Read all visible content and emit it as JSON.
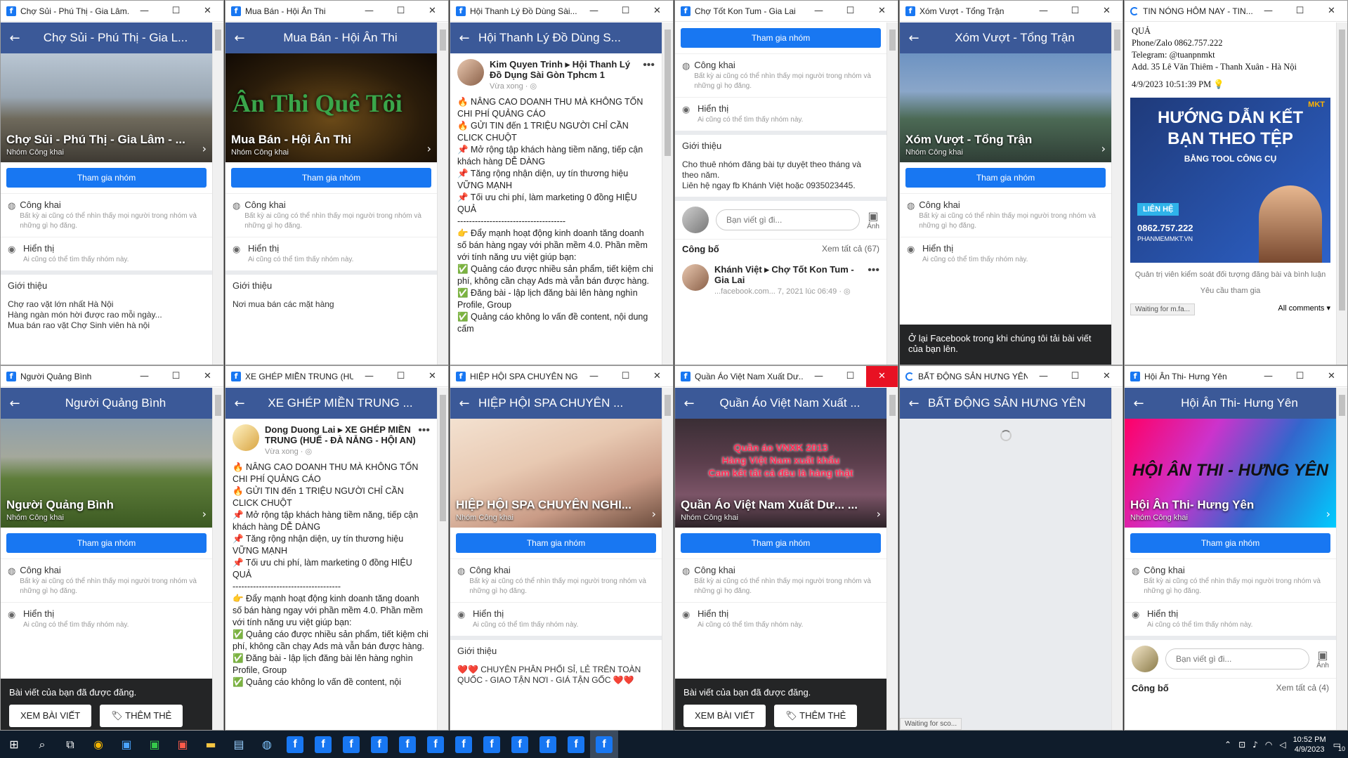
{
  "win1": {
    "tab_title": "Chợ Sủi - Phú Thị - Gia Lâm...",
    "nav_title": "Chợ Sủi - Phú Thị - Gia L...",
    "cover_name": "Chợ Sủi - Phú Thị - Gia Lâm - ...",
    "cover_type": "Nhóm Công khai",
    "join": "Tham gia nhóm",
    "public_title": "Công khai",
    "public_desc": "Bất kỳ ai cũng có thể nhìn thấy mọi người trong nhóm và những gì họ đăng.",
    "visible_title": "Hiển thị",
    "visible_desc": "Ai cũng có thể tìm thấy nhóm này.",
    "intro": "Giới thiệu",
    "about": "Chợ rao vặt lớn nhất Hà Nội\nHàng ngàn món hời được rao mỗi ngày...\nMua bán rao vặt Chợ Sinh viên hà nội"
  },
  "win2": {
    "tab_title": "Mua Bán - Hội Ân Thi",
    "nav_title": "Mua Bán - Hội Ân Thi",
    "cover_art": "Ân Thi Quê Tôi",
    "cover_name": "Mua Bán - Hội Ân Thi",
    "cover_type": "Nhóm Công khai",
    "join": "Tham gia nhóm",
    "public_title": "Công khai",
    "public_desc": "Bất kỳ ai cũng có thể nhìn thấy mọi người trong nhóm và những gì họ đăng.",
    "visible_title": "Hiển thị",
    "visible_desc": "Ai cũng có thể tìm thấy nhóm này.",
    "intro": "Giới thiệu",
    "about": "Nơi mua bán các mặt hàng"
  },
  "win3": {
    "tab_title": "Hội Thanh Lý Đồ Dùng Sài...",
    "nav_title": "Hội Thanh Lý Đồ Dùng S...",
    "author": "Kim Quyen Trinh ▸ Hội Thanh Lý Đồ Dụng Sài Gòn Tphcm 1",
    "time": "Vừa xong · ◎",
    "body": "🔥 NÂNG CAO DOANH THU MÀ KHÔNG TỐN CHI PHÍ QUẢNG CÁO\n🔥 GỬI TIN đến 1 TRIỆU NGƯỜI CHỈ CẦN CLICK CHUỘT\n📌 Mở rộng tập khách hàng tiềm năng, tiếp cận khách hàng DỄ DÀNG\n📌 Tăng rộng nhận diện, uy tín thương hiệu VỮNG MẠNH\n📌 Tối ưu chi phí, làm marketing 0 đồng HIỆU QUẢ\n-------------------------------------\n👉 Đẩy mạnh hoạt động kinh doanh tăng doanh số bán hàng ngay với phần mềm 4.0. Phần mềm với tính năng ưu việt giúp bạn:\n✅ Quảng cáo được nhiều sản phẩm, tiết kiệm chi phí, không cần chạy Ads mà vẫn bán được hàng.\n✅ Đăng bài - lập lịch đăng bài lên hàng nghìn Profile, Group\n✅ Quảng cáo không lo vấn đề content, nội dung cấm"
  },
  "win4": {
    "tab_title": "Chợ Tốt Kon Tum - Gia Lai",
    "join": "Tham gia nhóm",
    "public_title": "Công khai",
    "public_desc": "Bất kỳ ai cũng có thể nhìn thấy mọi người trong nhóm và những gì họ đăng.",
    "visible_title": "Hiển thị",
    "visible_desc": "Ai cũng có thể tìm thấy nhóm này.",
    "intro": "Giới thiệu",
    "about": "Cho thuê nhóm đăng bài tự duyệt theo tháng và theo năm.\nLiên hệ ngay fb Khánh Việt hoặc 0935023445.",
    "compose_placeholder": "Bạn viết gì đi...",
    "photo_label": "Ảnh",
    "public_posts": "Công bố",
    "see_all": "Xem tất cả (67)",
    "post_author": "Khánh Việt ▸ Chợ Tốt Kon Tum - Gia Lai",
    "post_time": "...facebook.com... 7, 2021 lúc 06:49 · ◎"
  },
  "win5": {
    "tab_title": "Xóm Vượt - Tổng Trận",
    "nav_title": "Xóm Vượt - Tổng Trận",
    "cover_name": "Xóm Vượt - Tổng Trận",
    "cover_type": "Nhóm Công khai",
    "join": "Tham gia nhóm",
    "public_title": "Công khai",
    "public_desc": "Bất kỳ ai cũng có thể nhìn thấy mọi người trong nhóm và những gì họ đăng.",
    "visible_title": "Hiển thị",
    "visible_desc": "Ai cũng có thể tìm thấy nhóm này.",
    "toast": "Ở lại Facebook trong khi chúng tôi tải bài viết của bạn lên."
  },
  "win6": {
    "tab_title": "TIN NÓNG HÔM NAY - TIN...",
    "news": "QUẢ\nPhone/Zalo 0862.757.222\nTelegram: @tuanpnmkt\nAdd. 35 Lê Văn Thiêm - Thanh Xuân - Hà Nội",
    "date": "4/9/2023 10:51:39 PM 💡",
    "ad_brand": "MKT",
    "ad_title": "HƯỚNG DẪN KẾT BẠN THEO TỆP",
    "ad_sub": "BẰNG TOOL CÔNG CỤ",
    "ad_contact": "LIÊN HỆ",
    "ad_phone": "0862.757.222",
    "ad_site": "PHANMEMMKT.VN",
    "admin_note": "Quản trị viên kiểm soát đối tượng đăng bài và bình luận",
    "request": "Yêu cầu tham gia",
    "status": "Waiting for m.fa...",
    "comments": "All comments ▾"
  },
  "win7": {
    "tab_title": "Người Quảng Bình",
    "nav_title": "Người Quảng Bình",
    "cover_name": "Người Quảng Bình",
    "cover_type": "Nhóm Công khai",
    "join": "Tham gia nhóm",
    "public_title": "Công khai",
    "public_desc": "Bất kỳ ai cũng có thể nhìn thấy mọi người trong nhóm và những gì họ đăng.",
    "visible_title": "Hiển thị",
    "visible_desc": "Ai cũng có thể tìm thấy nhóm này.",
    "toast": "Bài viết của bạn đã được đăng.",
    "view_post": "XEM BÀI VIẾT",
    "add_tag": "🏷 THÊM THẺ"
  },
  "win8": {
    "tab_title": "XE GHÉP MIỀN TRUNG (HU...",
    "nav_title": "XE GHÉP MIỀN TRUNG ...",
    "author": "Dong Duong Lai ▸ XE GHÉP MIỀN TRUNG (HUẾ - ĐÀ NẴNG - HỘI AN)",
    "time": "Vừa xong · ◎",
    "body": "🔥 NÂNG CAO DOANH THU MÀ KHÔNG TỐN CHI PHÍ QUẢNG CÁO\n🔥 GỬI TIN đến 1 TRIỆU NGƯỜI CHỈ CẦN CLICK CHUỘT\n📌 Mở rộng tập khách hàng tiềm năng, tiếp cận khách hàng DỄ DÀNG\n📌 Tăng rộng nhận diện, uy tín thương hiệu VỮNG MẠNH\n📌 Tối ưu chi phí, làm marketing 0 đồng HIỆU QUẢ\n-------------------------------------\n👉 Đẩy mạnh hoạt động kinh doanh tăng doanh số bán hàng ngay với phần mềm 4.0. Phần mềm với tính năng ưu việt giúp bạn:\n✅ Quảng cáo được nhiều sản phẩm, tiết kiệm chi phí, không cần chạy Ads mà vẫn bán được hàng.\n✅ Đăng bài - lập lịch đăng bài lên hàng nghìn Profile, Group\n✅ Quảng cáo không lo vấn đề content, nội"
  },
  "win9": {
    "tab_title": "HIỆP HỘI SPA CHUYÊN NG...",
    "nav_title": "HIỆP HỘI SPA CHUYÊN ...",
    "cover_name": "HIỆP HỘI SPA CHUYÊN NGHI...",
    "cover_type": "Nhóm Công khai",
    "join": "Tham gia nhóm",
    "public_title": "Công khai",
    "public_desc": "Bất kỳ ai cũng có thể nhìn thấy mọi người trong nhóm và những gì họ đăng.",
    "visible_title": "Hiển thị",
    "visible_desc": "Ai cũng có thể tìm thấy nhóm này.",
    "intro": "Giới thiệu",
    "about": "❤️❤️ CHUYÊN PHÂN PHỐI SỈ, LẺ TRÊN TOÀN QUỐC - GIAO TẬN NƠI - GIÁ TẬN GỐC ❤️❤️"
  },
  "win10": {
    "tab_title": "Quần Áo Việt Nam Xuất Dư...",
    "nav_title": "Quần Áo Việt Nam Xuất ...",
    "cover_art": "Quần áo VNXK 2013\nHàng Việt Nam xuất khẩu\nCam kết tất cả đều là hàng thật",
    "cover_name": "Quần Áo Việt Nam Xuất Dư... ...",
    "cover_type": "Nhóm Công khai",
    "join": "Tham gia nhóm",
    "public_title": "Công khai",
    "public_desc": "Bất kỳ ai cũng có thể nhìn thấy mọi người trong nhóm và những gì họ đăng.",
    "visible_title": "Hiển thị",
    "visible_desc": "Ai cũng có thể tìm thấy nhóm này.",
    "toast": "Bài viết của bạn đã được đăng.",
    "view_post": "XEM BÀI VIẾT",
    "add_tag": "🏷 THÊM THẺ"
  },
  "win11": {
    "tab_title": "BẤT ĐỘNG SẢN HƯNG YÊN",
    "nav_title": "BẤT ĐỘNG SẢN HƯNG YÊN",
    "status": "Waiting for sco..."
  },
  "win12": {
    "tab_title": "Hội Ân Thi- Hưng Yên",
    "nav_title": "Hội Ân Thi- Hưng Yên",
    "cover_art": "HỘI ÂN THI - HƯNG YÊN",
    "cover_name": "Hội Ân Thi- Hưng Yên",
    "cover_type": "Nhóm Công khai",
    "join": "Tham gia nhóm",
    "public_title": "Công khai",
    "public_desc": "Bất kỳ ai cũng có thể nhìn thấy mọi người trong nhóm và những gì họ đăng.",
    "visible_title": "Hiển thị",
    "visible_desc": "Ai cũng có thể tìm thấy nhóm này.",
    "compose_placeholder": "Bạn viết gì đi...",
    "photo_label": "Ảnh",
    "public_posts": "Công bố",
    "see_all": "Xem tất cả (4)"
  },
  "taskbar": {
    "time": "10:52 PM",
    "date": "4/9/2023",
    "notifications": "10"
  },
  "icons": {
    "fb": "f",
    "back": "←",
    "chevron": "›",
    "globe": "◍",
    "eye": "◉",
    "minimize": "—",
    "maximize": "☐",
    "close": "✕",
    "dots": "•••"
  }
}
